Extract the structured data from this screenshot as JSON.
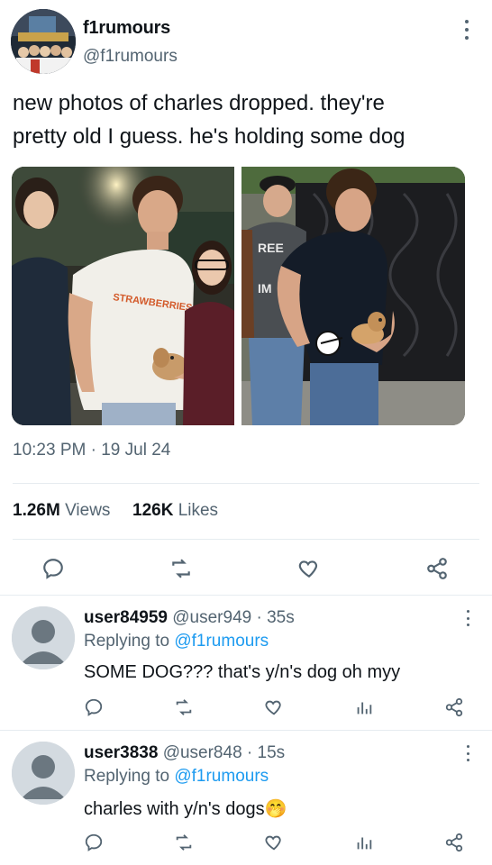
{
  "account": {
    "display_name": "f1rumours",
    "handle": "@f1rumours"
  },
  "tweet": {
    "text": "new photos of charles dropped. they're\npretty old I guess. he's holding some dog",
    "time": "10:23 PM",
    "date": "19 Jul 24",
    "views_count": "1.26M",
    "views_label": "Views",
    "likes_count": "126K",
    "likes_label": "Likes",
    "photo_1_shirt_text": "STRAWBERRIES",
    "photo_2_shirt_text_1": "REE",
    "photo_2_shirt_text_2": "IM"
  },
  "replies": [
    {
      "name": "user84959",
      "handle": "@user949",
      "time": "35s",
      "replying_prefix": "Replying to",
      "replying_to": "@f1rumours",
      "text": "SOME DOG??? that's y/n's dog oh myy"
    },
    {
      "name": "user3838",
      "handle": "@user848",
      "time": "15s",
      "replying_prefix": "Replying to",
      "replying_to": "@f1rumours",
      "text": "charles with y/n's dogs",
      "emoji": "🤭"
    }
  ],
  "icons": {
    "reply": "reply-icon",
    "retweet": "retweet-icon",
    "like": "heart-icon",
    "share": "share-icon",
    "views": "views-icon",
    "more": "more-icon"
  },
  "colors": {
    "accent": "#1d9bf0",
    "secondary_text": "#536471",
    "primary_text": "#0f1419",
    "divider": "#e6ecf0"
  }
}
